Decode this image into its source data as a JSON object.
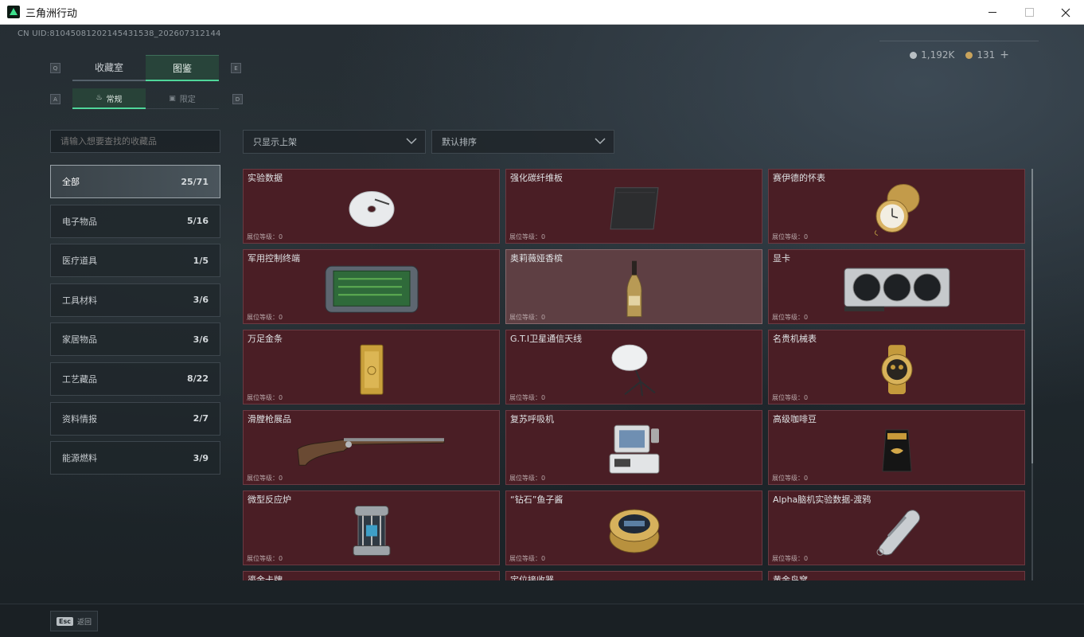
{
  "window": {
    "title": "三角洲行动"
  },
  "header": {
    "uid": "CN UID:8104508120214543​1538_202607312144",
    "currency": [
      {
        "icon": "silver-coin-icon",
        "value": "1,192K"
      },
      {
        "icon": "gold-coin-icon",
        "value": "131"
      }
    ],
    "plus_label": "+"
  },
  "tabs": {
    "key_left": "Q",
    "key_right": "E",
    "items": [
      {
        "label": "收藏室",
        "active": false
      },
      {
        "label": "图鉴",
        "active": true
      }
    ]
  },
  "subtabs": {
    "key_left": "A",
    "key_right": "D",
    "items": [
      {
        "label": "常规",
        "icon": "flame-icon",
        "active": true
      },
      {
        "label": "限定",
        "icon": "frame-icon",
        "active": false
      }
    ]
  },
  "search": {
    "placeholder": "请输入想要查找的收藏品"
  },
  "filters": {
    "shelf": "只显示上架",
    "sort": "默认排序"
  },
  "categories": [
    {
      "label": "全部",
      "count": "25/71",
      "active": true
    },
    {
      "label": "电子物品",
      "count": "5/16"
    },
    {
      "label": "医疗道具",
      "count": "1/5"
    },
    {
      "label": "工具材料",
      "count": "3/6"
    },
    {
      "label": "家居物品",
      "count": "3/6"
    },
    {
      "label": "工艺藏品",
      "count": "8/22"
    },
    {
      "label": "资料情报",
      "count": "2/7"
    },
    {
      "label": "能源燃料",
      "count": "3/9"
    }
  ],
  "items": [
    {
      "name": "实验数据",
      "level": "展位等级：0",
      "icon": "disc-icon"
    },
    {
      "name": "强化碳纤维板",
      "level": "展位等级：0",
      "icon": "carbon-plate-icon"
    },
    {
      "name": "赛伊德的怀表",
      "level": "展位等级：0",
      "icon": "pocket-watch-icon"
    },
    {
      "name": "军用控制终端",
      "level": "展位等级：0",
      "icon": "control-terminal-icon"
    },
    {
      "name": "奥莉薇娅香槟",
      "level": "展位等级：0",
      "icon": "champagne-bottle-icon",
      "highlight": true
    },
    {
      "name": "显卡",
      "level": "展位等级：0",
      "icon": "graphics-card-icon"
    },
    {
      "name": "万足金条",
      "level": "展位等级：0",
      "icon": "gold-bar-icon"
    },
    {
      "name": "G.T.I卫星通信天线",
      "level": "展位等级：0",
      "icon": "satellite-dish-icon"
    },
    {
      "name": "名贵机械表",
      "level": "展位等级：0",
      "icon": "wristwatch-icon"
    },
    {
      "name": "滑膛枪展品",
      "level": "展位等级：0",
      "icon": "musket-icon"
    },
    {
      "name": "复苏呼吸机",
      "level": "展位等级：0",
      "icon": "ventilator-icon"
    },
    {
      "name": "高级咖啡豆",
      "level": "展位等级：0",
      "icon": "coffee-bag-icon"
    },
    {
      "name": "微型反应炉",
      "level": "展位等级：0",
      "icon": "reactor-icon"
    },
    {
      "name": "“钻石”鱼子酱",
      "level": "展位等级：0",
      "icon": "caviar-tin-icon"
    },
    {
      "name": "Alpha脑机实验数据-渡鸦",
      "level": "展位等级：0",
      "icon": "data-drive-icon"
    },
    {
      "name": "鎏金卡牌",
      "level": "",
      "icon": ""
    },
    {
      "name": "定位接收器",
      "level": "",
      "icon": ""
    },
    {
      "name": "黄金鸟窝",
      "level": "",
      "icon": ""
    }
  ],
  "footer": {
    "esc_key": "Esc",
    "back_label": "返回"
  }
}
